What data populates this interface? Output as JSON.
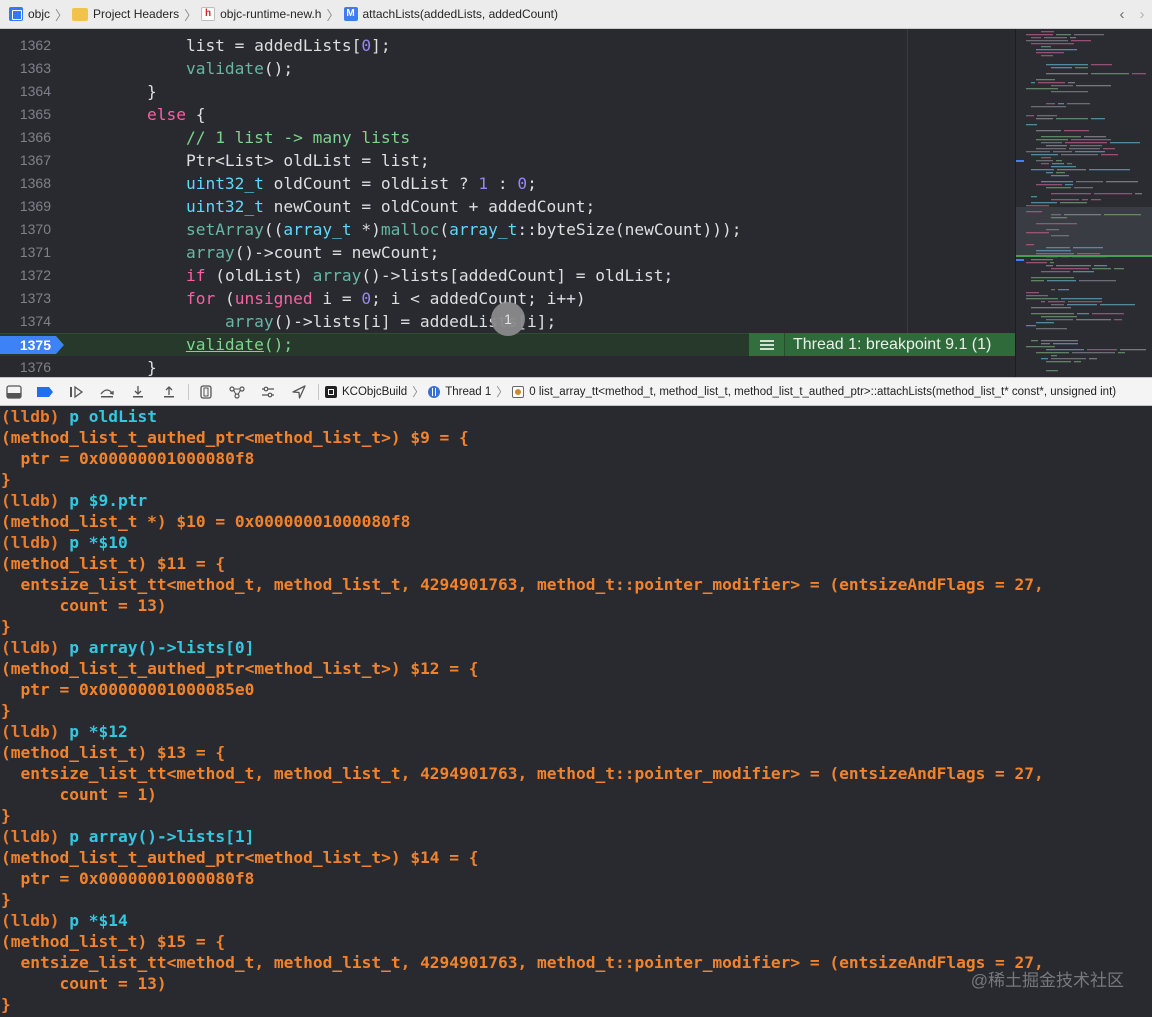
{
  "breadcrumb": {
    "items": [
      {
        "label": "objc",
        "icon": "project-icon"
      },
      {
        "label": "Project Headers",
        "icon": "folder-icon"
      },
      {
        "label": "objc-runtime-new.h",
        "icon": "header-file-icon"
      },
      {
        "label": "attachLists(addedLists, addedCount)",
        "icon": "method-icon"
      }
    ],
    "back_glyph": "‹",
    "forward_glyph": "›"
  },
  "editor": {
    "lines": [
      {
        "num": "1362",
        "tokens": [
          {
            "t": "            list = addedLists[",
            "c": ""
          },
          {
            "t": "0",
            "c": "t-num2"
          },
          {
            "t": "];",
            "c": ""
          }
        ]
      },
      {
        "num": "1363",
        "tokens": [
          {
            "t": "            ",
            "c": ""
          },
          {
            "t": "validate",
            "c": "t-fn"
          },
          {
            "t": "();",
            "c": ""
          }
        ]
      },
      {
        "num": "1364",
        "tokens": [
          {
            "t": "        }",
            "c": ""
          }
        ]
      },
      {
        "num": "1365",
        "tokens": [
          {
            "t": "        ",
            "c": ""
          },
          {
            "t": "else",
            "c": "t-kw"
          },
          {
            "t": " {",
            "c": ""
          }
        ]
      },
      {
        "num": "1366",
        "tokens": [
          {
            "t": "            ",
            "c": ""
          },
          {
            "t": "// 1 list -> many lists",
            "c": "t-green"
          }
        ]
      },
      {
        "num": "1367",
        "tokens": [
          {
            "t": "            Ptr<List> oldList = list;",
            "c": ""
          }
        ]
      },
      {
        "num": "1368",
        "tokens": [
          {
            "t": "            ",
            "c": ""
          },
          {
            "t": "uint32_t",
            "c": "t-type"
          },
          {
            "t": " oldCount = oldList ? ",
            "c": ""
          },
          {
            "t": "1",
            "c": "t-num2"
          },
          {
            "t": " : ",
            "c": ""
          },
          {
            "t": "0",
            "c": "t-num2"
          },
          {
            "t": ";",
            "c": ""
          }
        ]
      },
      {
        "num": "1369",
        "tokens": [
          {
            "t": "            ",
            "c": ""
          },
          {
            "t": "uint32_t",
            "c": "t-type"
          },
          {
            "t": " newCount = oldCount + addedCount;",
            "c": ""
          }
        ]
      },
      {
        "num": "1370",
        "tokens": [
          {
            "t": "            ",
            "c": ""
          },
          {
            "t": "setArray",
            "c": "t-fn"
          },
          {
            "t": "((",
            "c": ""
          },
          {
            "t": "array_t",
            "c": "t-type"
          },
          {
            "t": " *)",
            "c": ""
          },
          {
            "t": "malloc",
            "c": "t-fn"
          },
          {
            "t": "(",
            "c": ""
          },
          {
            "t": "array_t",
            "c": "t-type"
          },
          {
            "t": "::byteSize(newCount)));",
            "c": ""
          }
        ]
      },
      {
        "num": "1371",
        "tokens": [
          {
            "t": "            ",
            "c": ""
          },
          {
            "t": "array",
            "c": "t-fn"
          },
          {
            "t": "()->count = newCount;",
            "c": ""
          }
        ]
      },
      {
        "num": "1372",
        "tokens": [
          {
            "t": "            ",
            "c": ""
          },
          {
            "t": "if",
            "c": "t-kw"
          },
          {
            "t": " (oldList) ",
            "c": ""
          },
          {
            "t": "array",
            "c": "t-fn"
          },
          {
            "t": "()->lists[addedCount] = oldList;",
            "c": ""
          }
        ]
      },
      {
        "num": "1373",
        "tokens": [
          {
            "t": "            ",
            "c": ""
          },
          {
            "t": "for",
            "c": "t-kw"
          },
          {
            "t": " (",
            "c": ""
          },
          {
            "t": "unsigned",
            "c": "t-kw"
          },
          {
            "t": " i = ",
            "c": ""
          },
          {
            "t": "0",
            "c": "t-num2"
          },
          {
            "t": "; i < addedCount; i++)",
            "c": ""
          }
        ]
      },
      {
        "num": "1374",
        "tokens": [
          {
            "t": "                ",
            "c": ""
          },
          {
            "t": "array",
            "c": "t-fn"
          },
          {
            "t": "()->lists[i] = addedLists[i];",
            "c": ""
          }
        ]
      },
      {
        "num": "1375",
        "tokens": [
          {
            "t": "            ",
            "c": ""
          },
          {
            "t": "validate",
            "c": "t-fn"
          },
          {
            "t": "();",
            "c": ""
          }
        ]
      },
      {
        "num": "1376",
        "tokens": [
          {
            "t": "        }",
            "c": ""
          }
        ]
      }
    ],
    "current_line": "1375",
    "breakpoint_label": "Thread 1: breakpoint 9.1 (1)",
    "overlay_badge": "1",
    "colors": {
      "background": "#292a30",
      "current_line": "#26392a",
      "breakpoint_green": "#2f6a3a",
      "breakpoint_arrow": "#3d82f6"
    }
  },
  "debugbar": {
    "target": "KCObjcBuild",
    "thread": "Thread 1",
    "frame": "0 list_array_tt<method_t, method_list_t, method_list_t_authed_ptr>::attachLists(method_list_t* const*, unsigned int)"
  },
  "console": {
    "lines": [
      {
        "kind": "cmd",
        "prompt": "(lldb)",
        "text": "p oldList"
      },
      {
        "kind": "out",
        "text": "(method_list_t_authed_ptr<method_list_t>) $9 = {"
      },
      {
        "kind": "out",
        "text": "  ptr = 0x00000001000080f8"
      },
      {
        "kind": "out",
        "text": "}"
      },
      {
        "kind": "cmd",
        "prompt": "(lldb)",
        "text": "p $9.ptr"
      },
      {
        "kind": "out",
        "text": "(method_list_t *) $10 = 0x00000001000080f8"
      },
      {
        "kind": "cmd",
        "prompt": "(lldb)",
        "text": "p *$10"
      },
      {
        "kind": "out",
        "text": "(method_list_t) $11 = {"
      },
      {
        "kind": "out",
        "text": "  entsize_list_tt<method_t, method_list_t, 4294901763, method_t::pointer_modifier> = (entsizeAndFlags = 27,"
      },
      {
        "kind": "out",
        "text": "      count = 13)"
      },
      {
        "kind": "out",
        "text": "}"
      },
      {
        "kind": "cmd",
        "prompt": "(lldb)",
        "text": "p array()->lists[0]"
      },
      {
        "kind": "out",
        "text": "(method_list_t_authed_ptr<method_list_t>) $12 = {"
      },
      {
        "kind": "out",
        "text": "  ptr = 0x00000001000085e0"
      },
      {
        "kind": "out",
        "text": "}"
      },
      {
        "kind": "cmd",
        "prompt": "(lldb)",
        "text": "p *$12"
      },
      {
        "kind": "out",
        "text": "(method_list_t) $13 = {"
      },
      {
        "kind": "out",
        "text": "  entsize_list_tt<method_t, method_list_t, 4294901763, method_t::pointer_modifier> = (entsizeAndFlags = 27,"
      },
      {
        "kind": "out",
        "text": "      count = 1)"
      },
      {
        "kind": "out",
        "text": "}"
      },
      {
        "kind": "cmd",
        "prompt": "(lldb)",
        "text": "p array()->lists[1]"
      },
      {
        "kind": "out",
        "text": "(method_list_t_authed_ptr<method_list_t>) $14 = {"
      },
      {
        "kind": "out",
        "text": "  ptr = 0x00000001000080f8"
      },
      {
        "kind": "out",
        "text": "}"
      },
      {
        "kind": "cmd",
        "prompt": "(lldb)",
        "text": "p *$14"
      },
      {
        "kind": "out",
        "text": "(method_list_t) $15 = {"
      },
      {
        "kind": "out",
        "text": "  entsize_list_tt<method_t, method_list_t, 4294901763, method_t::pointer_modifier> = (entsizeAndFlags = 27,"
      },
      {
        "kind": "out",
        "text": "      count = 13)"
      },
      {
        "kind": "out",
        "text": "}"
      }
    ],
    "colors": {
      "output": "#f2832b",
      "command": "#32c8e0"
    }
  },
  "watermark": "@稀土掘金技术社区"
}
